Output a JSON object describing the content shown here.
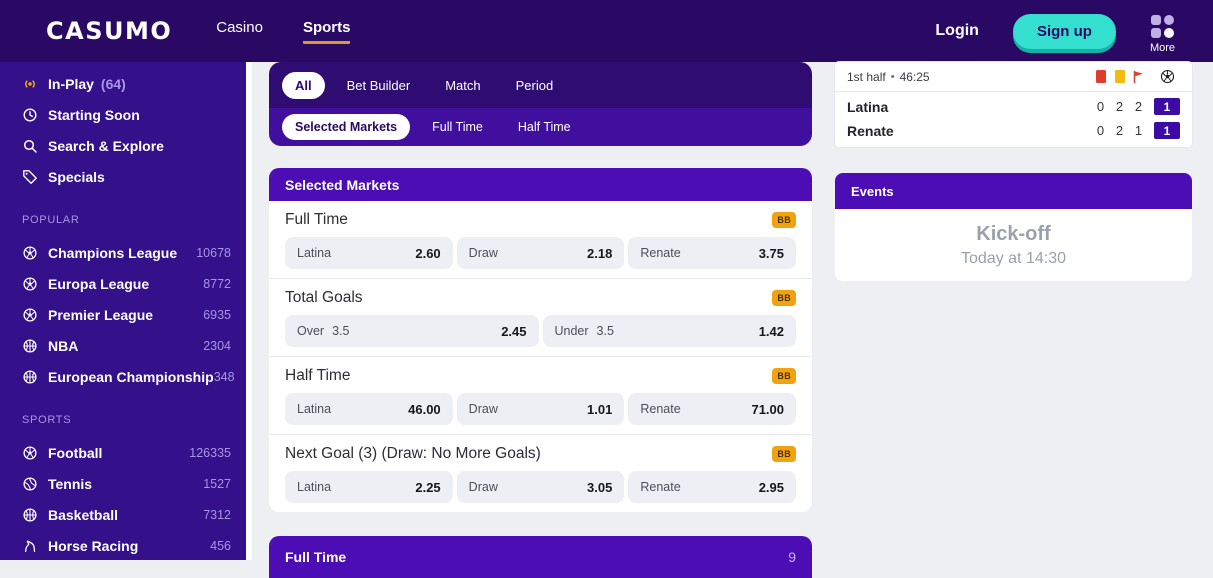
{
  "nav": {
    "logo": "CASUMO",
    "links": [
      {
        "label": "Casino",
        "active": false
      },
      {
        "label": "Sports",
        "active": true
      }
    ],
    "login_label": "Login",
    "signup_label": "Sign up",
    "more_label": "More"
  },
  "sidebar": {
    "top_items": [
      {
        "icon": "live-icon",
        "label": "In-Play",
        "count": "(64)"
      },
      {
        "icon": "clock-icon",
        "label": "Starting Soon",
        "count": ""
      },
      {
        "icon": "search-icon",
        "label": "Search & Explore",
        "count": ""
      },
      {
        "icon": "tag-icon",
        "label": "Specials",
        "count": ""
      }
    ],
    "popular_title": "POPULAR",
    "popular_items": [
      {
        "icon": "football-icon",
        "label": "Champions League",
        "count": "10678"
      },
      {
        "icon": "football-icon",
        "label": "Europa League",
        "count": "8772"
      },
      {
        "icon": "football-icon",
        "label": "Premier League",
        "count": "6935"
      },
      {
        "icon": "basketball-icon",
        "label": "NBA",
        "count": "2304"
      },
      {
        "icon": "basketball-icon",
        "label": "European Championship",
        "count": "348"
      }
    ],
    "sports_title": "SPORTS",
    "sports_items": [
      {
        "icon": "football-icon",
        "label": "Football",
        "count": "126335"
      },
      {
        "icon": "tennis-icon",
        "label": "Tennis",
        "count": "1527"
      },
      {
        "icon": "basketball-icon",
        "label": "Basketball",
        "count": "7312"
      },
      {
        "icon": "horse-icon",
        "label": "Horse Racing",
        "count": "456"
      }
    ]
  },
  "filters": {
    "row1": [
      {
        "label": "All",
        "selected": true
      },
      {
        "label": "Bet Builder",
        "selected": false
      },
      {
        "label": "Match",
        "selected": false
      },
      {
        "label": "Period",
        "selected": false
      }
    ],
    "row2": [
      {
        "label": "Selected Markets",
        "selected": true
      },
      {
        "label": "Full Time",
        "selected": false
      },
      {
        "label": "Half Time",
        "selected": false
      }
    ]
  },
  "markets": {
    "panel_title": "Selected Markets",
    "sections": [
      {
        "title": "Full Time",
        "badge": "BB",
        "odds": [
          {
            "name": "Latina",
            "line": "",
            "value": "2.60"
          },
          {
            "name": "Draw",
            "line": "",
            "value": "2.18"
          },
          {
            "name": "Renate",
            "line": "",
            "value": "3.75"
          }
        ]
      },
      {
        "title": "Total Goals",
        "badge": "BB",
        "odds": [
          {
            "name": "Over",
            "line": "3.5",
            "value": "2.45"
          },
          {
            "name": "Under",
            "line": "3.5",
            "value": "1.42"
          }
        ]
      },
      {
        "title": "Half Time",
        "badge": "BB",
        "odds": [
          {
            "name": "Latina",
            "line": "",
            "value": "46.00"
          },
          {
            "name": "Draw",
            "line": "",
            "value": "1.01"
          },
          {
            "name": "Renate",
            "line": "",
            "value": "71.00"
          }
        ]
      },
      {
        "title": "Next Goal (3) (Draw: No More Goals)",
        "badge": "BB",
        "odds": [
          {
            "name": "Latina",
            "line": "",
            "value": "2.25"
          },
          {
            "name": "Draw",
            "line": "",
            "value": "3.05"
          },
          {
            "name": "Renate",
            "line": "",
            "value": "2.95"
          }
        ]
      }
    ],
    "next_panel": {
      "title": "Full Time",
      "count": "9"
    }
  },
  "scoreboard": {
    "period": "1st half",
    "separator": "•",
    "clock": "46:25",
    "stat_icons": [
      "red-card-icon",
      "yellow-card-icon",
      "corner-flag-icon",
      "soccer-ball-icon"
    ],
    "rows": [
      {
        "team": "Latina",
        "red_cards": "0",
        "yellow_cards": "2",
        "corners": "2",
        "score": "1"
      },
      {
        "team": "Renate",
        "red_cards": "0",
        "yellow_cards": "2",
        "corners": "1",
        "score": "1"
      }
    ]
  },
  "events": {
    "title": "Events",
    "headline": "Kick-off",
    "subtext": "Today at 14:30"
  },
  "colors": {
    "nav_bg": "#2a0965",
    "sidebar_bg": "#34108a",
    "accent_purple": "#4c0eb4",
    "filter_row2_bg": "#400f9e",
    "signup_teal": "#35dfd0",
    "bb_badge": "#f0a30e",
    "live_yellow": "#f2b705",
    "score_box_purple": "#3b0ba3",
    "sports_underline": "#d99b2b",
    "count_lavender": "#a995e3",
    "red_card": "#df3d2e",
    "yellow_card": "#f2bb10"
  }
}
